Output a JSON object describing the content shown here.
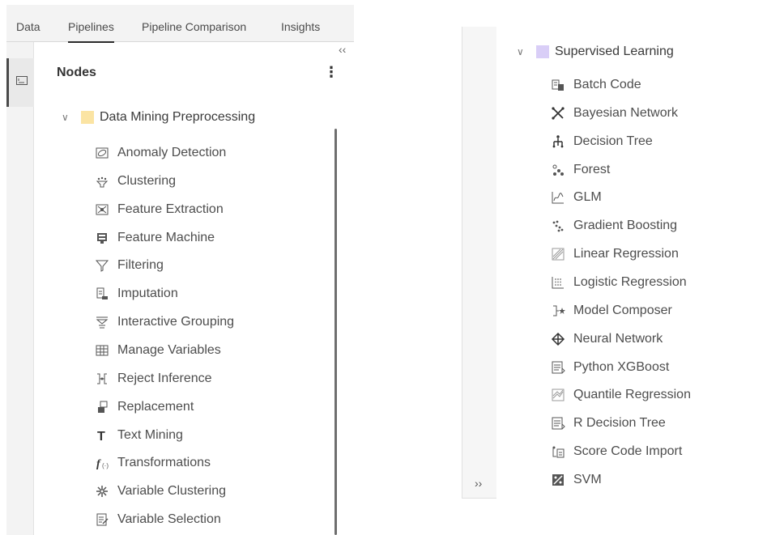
{
  "tabs": [
    {
      "label": "Data"
    },
    {
      "label": "Pipelines"
    },
    {
      "label": "Pipeline Comparison"
    },
    {
      "label": "Insights"
    }
  ],
  "active_tab": "Pipelines",
  "nodes_panel": {
    "title": "Nodes",
    "menu_glyph": "⋮",
    "collapse_glyph": "‹‹",
    "expand_glyph": "››"
  },
  "groups": [
    {
      "label": "Data Mining Preprocessing",
      "swatch_color": "#fbe4a3",
      "expanded": true,
      "items": [
        {
          "label": "Anomaly Detection",
          "icon": "anomaly-detection-icon"
        },
        {
          "label": "Clustering",
          "icon": "clustering-icon"
        },
        {
          "label": "Feature Extraction",
          "icon": "feature-extraction-icon"
        },
        {
          "label": "Feature Machine",
          "icon": "feature-machine-icon"
        },
        {
          "label": "Filtering",
          "icon": "filter-icon"
        },
        {
          "label": "Imputation",
          "icon": "imputation-icon"
        },
        {
          "label": "Interactive Grouping",
          "icon": "interactive-grouping-icon"
        },
        {
          "label": "Manage Variables",
          "icon": "manage-variables-icon"
        },
        {
          "label": "Reject Inference",
          "icon": "reject-inference-icon"
        },
        {
          "label": "Replacement",
          "icon": "replacement-icon"
        },
        {
          "label": "Text Mining",
          "icon": "text-mining-icon"
        },
        {
          "label": "Transformations",
          "icon": "transformations-icon"
        },
        {
          "label": "Variable Clustering",
          "icon": "variable-clustering-icon"
        },
        {
          "label": "Variable Selection",
          "icon": "variable-selection-icon"
        }
      ]
    },
    {
      "label": "Supervised Learning",
      "swatch_color": "#d9cef7",
      "expanded": true,
      "items": [
        {
          "label": "Batch Code",
          "icon": "batch-code-icon"
        },
        {
          "label": "Bayesian Network",
          "icon": "bayesian-network-icon"
        },
        {
          "label": "Decision Tree",
          "icon": "decision-tree-icon"
        },
        {
          "label": "Forest",
          "icon": "forest-icon"
        },
        {
          "label": "GLM",
          "icon": "glm-icon"
        },
        {
          "label": "Gradient Boosting",
          "icon": "gradient-boosting-icon"
        },
        {
          "label": "Linear Regression",
          "icon": "linear-regression-icon"
        },
        {
          "label": "Logistic Regression",
          "icon": "logistic-regression-icon"
        },
        {
          "label": "Model Composer",
          "icon": "model-composer-icon"
        },
        {
          "label": "Neural Network",
          "icon": "neural-network-icon"
        },
        {
          "label": "Python XGBoost",
          "icon": "python-xgboost-icon"
        },
        {
          "label": "Quantile Regression",
          "icon": "quantile-regression-icon"
        },
        {
          "label": "R Decision Tree",
          "icon": "r-decision-tree-icon"
        },
        {
          "label": "Score Code Import",
          "icon": "score-code-import-icon"
        },
        {
          "label": "SVM",
          "icon": "svm-icon"
        }
      ]
    }
  ]
}
